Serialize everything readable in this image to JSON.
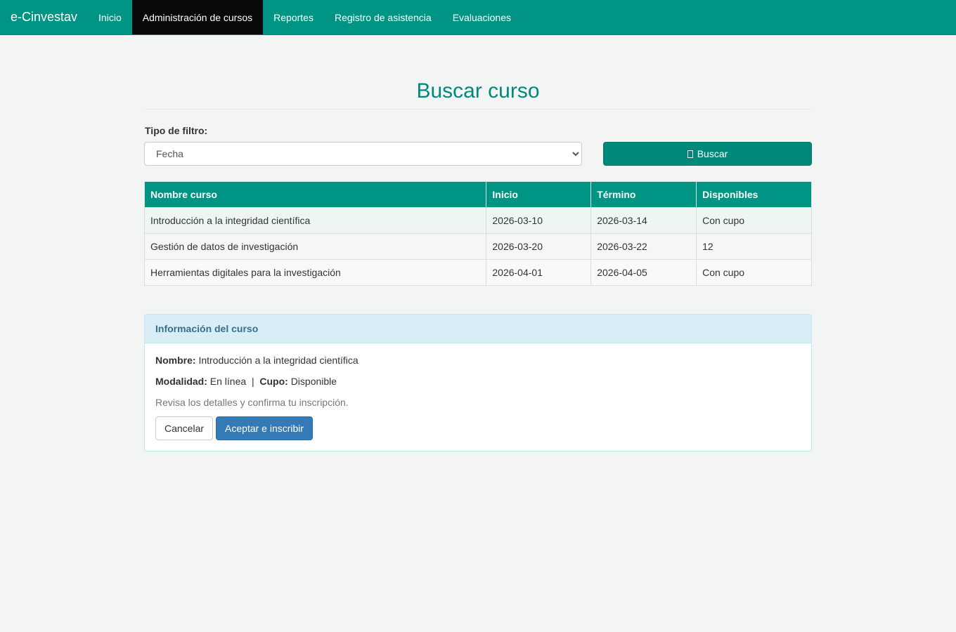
{
  "nav": {
    "brand": "e-Cinvestav",
    "items": [
      {
        "label": "Inicio",
        "active": false
      },
      {
        "label": "Administración de cursos",
        "active": true
      },
      {
        "label": "Reportes",
        "active": false
      },
      {
        "label": "Registro de asistencia",
        "active": false
      },
      {
        "label": "Evaluaciones",
        "active": false
      }
    ]
  },
  "page": {
    "title": "Buscar curso"
  },
  "filter": {
    "label": "Tipo de filtro:",
    "selected": "Fecha",
    "search_label": "Buscar",
    "search_icon": "search-icon"
  },
  "table": {
    "headers": [
      "Nombre curso",
      "Inicio",
      "Término",
      "Disponibles"
    ],
    "rows": [
      [
        "Introducción a la integridad científica",
        "2026-03-10",
        "2026-03-14",
        "Con cupo"
      ],
      [
        "Gestión de datos de investigación",
        "2026-03-20",
        "2026-03-22",
        "12"
      ],
      [
        "Herramientas digitales para la investigación",
        "2026-04-01",
        "2026-04-05",
        "Con cupo"
      ]
    ]
  },
  "info_panel": {
    "heading": "Información del curso",
    "name_label": "Nombre:",
    "name_value": "Introducción a la integridad científica",
    "modality_label": "Modalidad:",
    "modality_value": "En línea",
    "separator": "|",
    "quota_label": "Cupo:",
    "quota_value": "Disponible",
    "hint": "Revisa los detalles y confirma tu inscripción.",
    "cancel_label": "Cancelar",
    "accept_label": "Aceptar e inscribir"
  },
  "colors": {
    "navbar": "#009485",
    "active_nav": "#080808",
    "title": "#00897b",
    "primary_button": "#337ab7",
    "panel_heading": "#d9edf7"
  }
}
